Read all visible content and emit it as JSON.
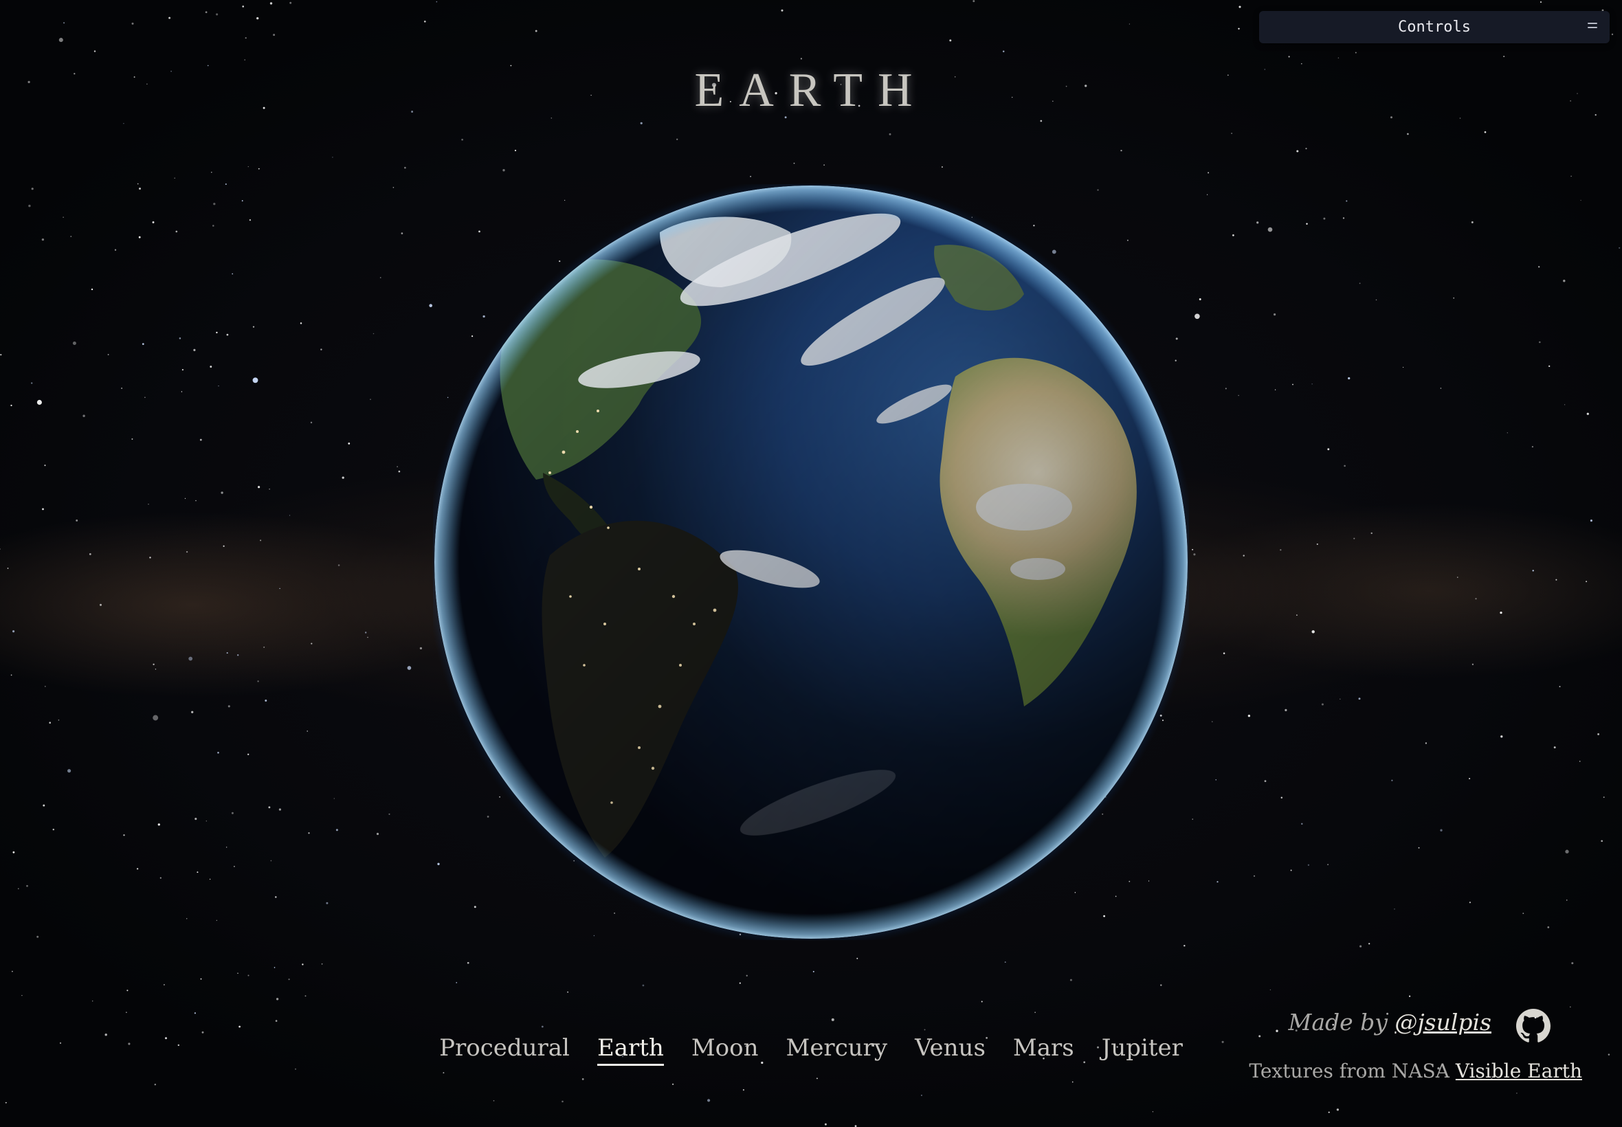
{
  "title": "EARTH",
  "controls": {
    "label": "Controls",
    "handle_icon": "drag-handle-icon"
  },
  "nav": {
    "items": [
      {
        "label": "Procedural",
        "active": false
      },
      {
        "label": "Earth",
        "active": true
      },
      {
        "label": "Moon",
        "active": false
      },
      {
        "label": "Mercury",
        "active": false
      },
      {
        "label": "Venus",
        "active": false
      },
      {
        "label": "Mars",
        "active": false
      },
      {
        "label": "Jupiter",
        "active": false
      }
    ]
  },
  "credits": {
    "made_by_prefix": "Made by",
    "author_handle": "@jsulpis",
    "github_icon": "github-icon",
    "textures_prefix": "Textures from NASA",
    "textures_link": "Visible Earth"
  },
  "colors": {
    "background": "#05060a",
    "atmosphere": "#3a9cff",
    "ocean": "#14305a",
    "panel": "#161a26",
    "text": "#c6c4c0"
  }
}
